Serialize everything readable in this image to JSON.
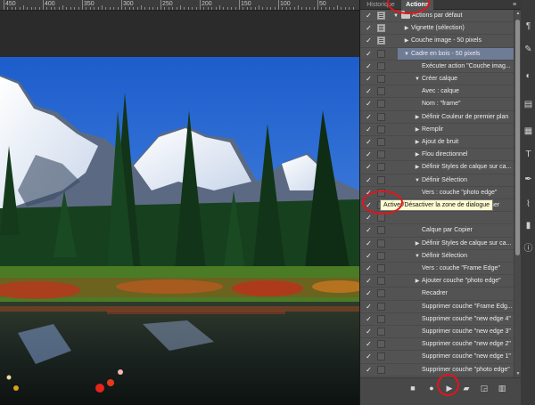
{
  "ruler": {
    "ticks": [
      "450",
      "400",
      "350",
      "300",
      "250",
      "200",
      "150",
      "100",
      "50"
    ]
  },
  "panel": {
    "tabs": [
      {
        "label": "Historique",
        "active": false
      },
      {
        "label": "Actions",
        "active": true
      }
    ],
    "menu_icon": "panel-menu-icon",
    "rows": [
      {
        "label": "Actions par défaut",
        "level": 0,
        "arrow": "down",
        "checked": true,
        "dialog": true,
        "folder": true,
        "selected": false
      },
      {
        "label": "Vignette (sélection)",
        "level": 1,
        "arrow": "right",
        "checked": true,
        "dialog": true,
        "selected": false
      },
      {
        "label": "Couche image - 50 pixels",
        "level": 1,
        "arrow": "right",
        "checked": true,
        "dialog": true,
        "selected": false
      },
      {
        "label": "Cadre en bois - 50 pixels",
        "level": 1,
        "arrow": "down",
        "checked": true,
        "dialog": false,
        "selected": true
      },
      {
        "label": "Exécuter action \"Couche imag...",
        "level": 3,
        "arrow": "",
        "checked": true,
        "dialog": false,
        "selected": false
      },
      {
        "label": "Créer calque",
        "level": 2,
        "arrow": "down",
        "checked": true,
        "dialog": false,
        "selected": false
      },
      {
        "label": "Avec : calque",
        "level": 3,
        "arrow": "",
        "checked": true,
        "dialog": false,
        "selected": false
      },
      {
        "label": "Nom : \"frame\"",
        "level": 3,
        "arrow": "",
        "checked": true,
        "dialog": false,
        "selected": false
      },
      {
        "label": "Définir Couleur de premier plan",
        "level": 2,
        "arrow": "right",
        "checked": true,
        "dialog": false,
        "selected": false
      },
      {
        "label": "Remplir",
        "level": 2,
        "arrow": "right",
        "checked": true,
        "dialog": false,
        "selected": false
      },
      {
        "label": "Ajout de bruit",
        "level": 2,
        "arrow": "right",
        "checked": true,
        "dialog": false,
        "selected": false
      },
      {
        "label": "Flou directionnel",
        "level": 2,
        "arrow": "right",
        "checked": true,
        "dialog": false,
        "selected": false
      },
      {
        "label": "Définir Styles de calque sur ca...",
        "level": 2,
        "arrow": "right",
        "checked": true,
        "dialog": false,
        "selected": false
      },
      {
        "label": "Définir Sélection",
        "level": 2,
        "arrow": "down",
        "checked": true,
        "dialog": false,
        "selected": false
      },
      {
        "label": "Vers : couche \"photo edge\"",
        "level": 3,
        "arrow": "",
        "checked": true,
        "dialog": false,
        "selected": false
      },
      {
        "label": "Sélection calque rapprocher",
        "level": 3,
        "arrow": "",
        "checked": true,
        "dialog": false,
        "selected": false
      },
      {
        "label": "",
        "level": 3,
        "arrow": "",
        "checked": true,
        "dialog": false,
        "selected": false
      },
      {
        "label": "Calque par Copier",
        "level": 3,
        "arrow": "",
        "checked": true,
        "dialog": false,
        "selected": false
      },
      {
        "label": "Définir Styles de calque sur ca...",
        "level": 2,
        "arrow": "right",
        "checked": true,
        "dialog": false,
        "selected": false
      },
      {
        "label": "Définir Sélection",
        "level": 2,
        "arrow": "down",
        "checked": true,
        "dialog": false,
        "selected": false
      },
      {
        "label": "Vers : couche \"Frame Edge\"",
        "level": 3,
        "arrow": "",
        "checked": true,
        "dialog": false,
        "selected": false
      },
      {
        "label": "Ajouter couche \"photo edge\"",
        "level": 2,
        "arrow": "right",
        "checked": true,
        "dialog": false,
        "selected": false
      },
      {
        "label": "Recadrer",
        "level": 3,
        "arrow": "",
        "checked": true,
        "dialog": false,
        "selected": false
      },
      {
        "label": "Supprimer couche \"Frame Edg...",
        "level": 3,
        "arrow": "",
        "checked": true,
        "dialog": false,
        "selected": false
      },
      {
        "label": "Supprimer couche \"new edge 4\"",
        "level": 3,
        "arrow": "",
        "checked": true,
        "dialog": false,
        "selected": false
      },
      {
        "label": "Supprimer couche \"new edge 3\"",
        "level": 3,
        "arrow": "",
        "checked": true,
        "dialog": false,
        "selected": false
      },
      {
        "label": "Supprimer couche \"new edge 2\"",
        "level": 3,
        "arrow": "",
        "checked": true,
        "dialog": false,
        "selected": false
      },
      {
        "label": "Supprimer couche \"new edge 1\"",
        "level": 3,
        "arrow": "",
        "checked": true,
        "dialog": false,
        "selected": false
      },
      {
        "label": "Supprimer couche \"photo edge\"",
        "level": 3,
        "arrow": "",
        "checked": true,
        "dialog": false,
        "selected": false
      },
      {
        "label": "Définir Sélection",
        "level": 2,
        "arrow": "right",
        "checked": true,
        "dialog": false,
        "selected": false
      },
      {
        "label": "Ombre portée (texte)",
        "level": 1,
        "arrow": "right",
        "checked": true,
        "dialog": true,
        "selected": false
      }
    ],
    "bottom_icons": [
      "stop-icon",
      "record-icon",
      "play-icon",
      "new-set-folder-icon",
      "new-action-icon",
      "trash-icon"
    ]
  },
  "tooltip": {
    "text": "Activer/Désactiver la zone de dialogue"
  },
  "tool_strip": {
    "icons": [
      "paragraph-icon",
      "brush-icon",
      "adjust-icon",
      "layers-icon",
      "swatches-icon",
      "type-icon",
      "pen-icon",
      "path-icon",
      "histogram-icon",
      "info-icon"
    ]
  },
  "colors": {
    "panel_bg": "#535353",
    "selection": "#6e7c95",
    "tooltip_bg": "#fffbd0",
    "annotation": "#e3141b"
  }
}
